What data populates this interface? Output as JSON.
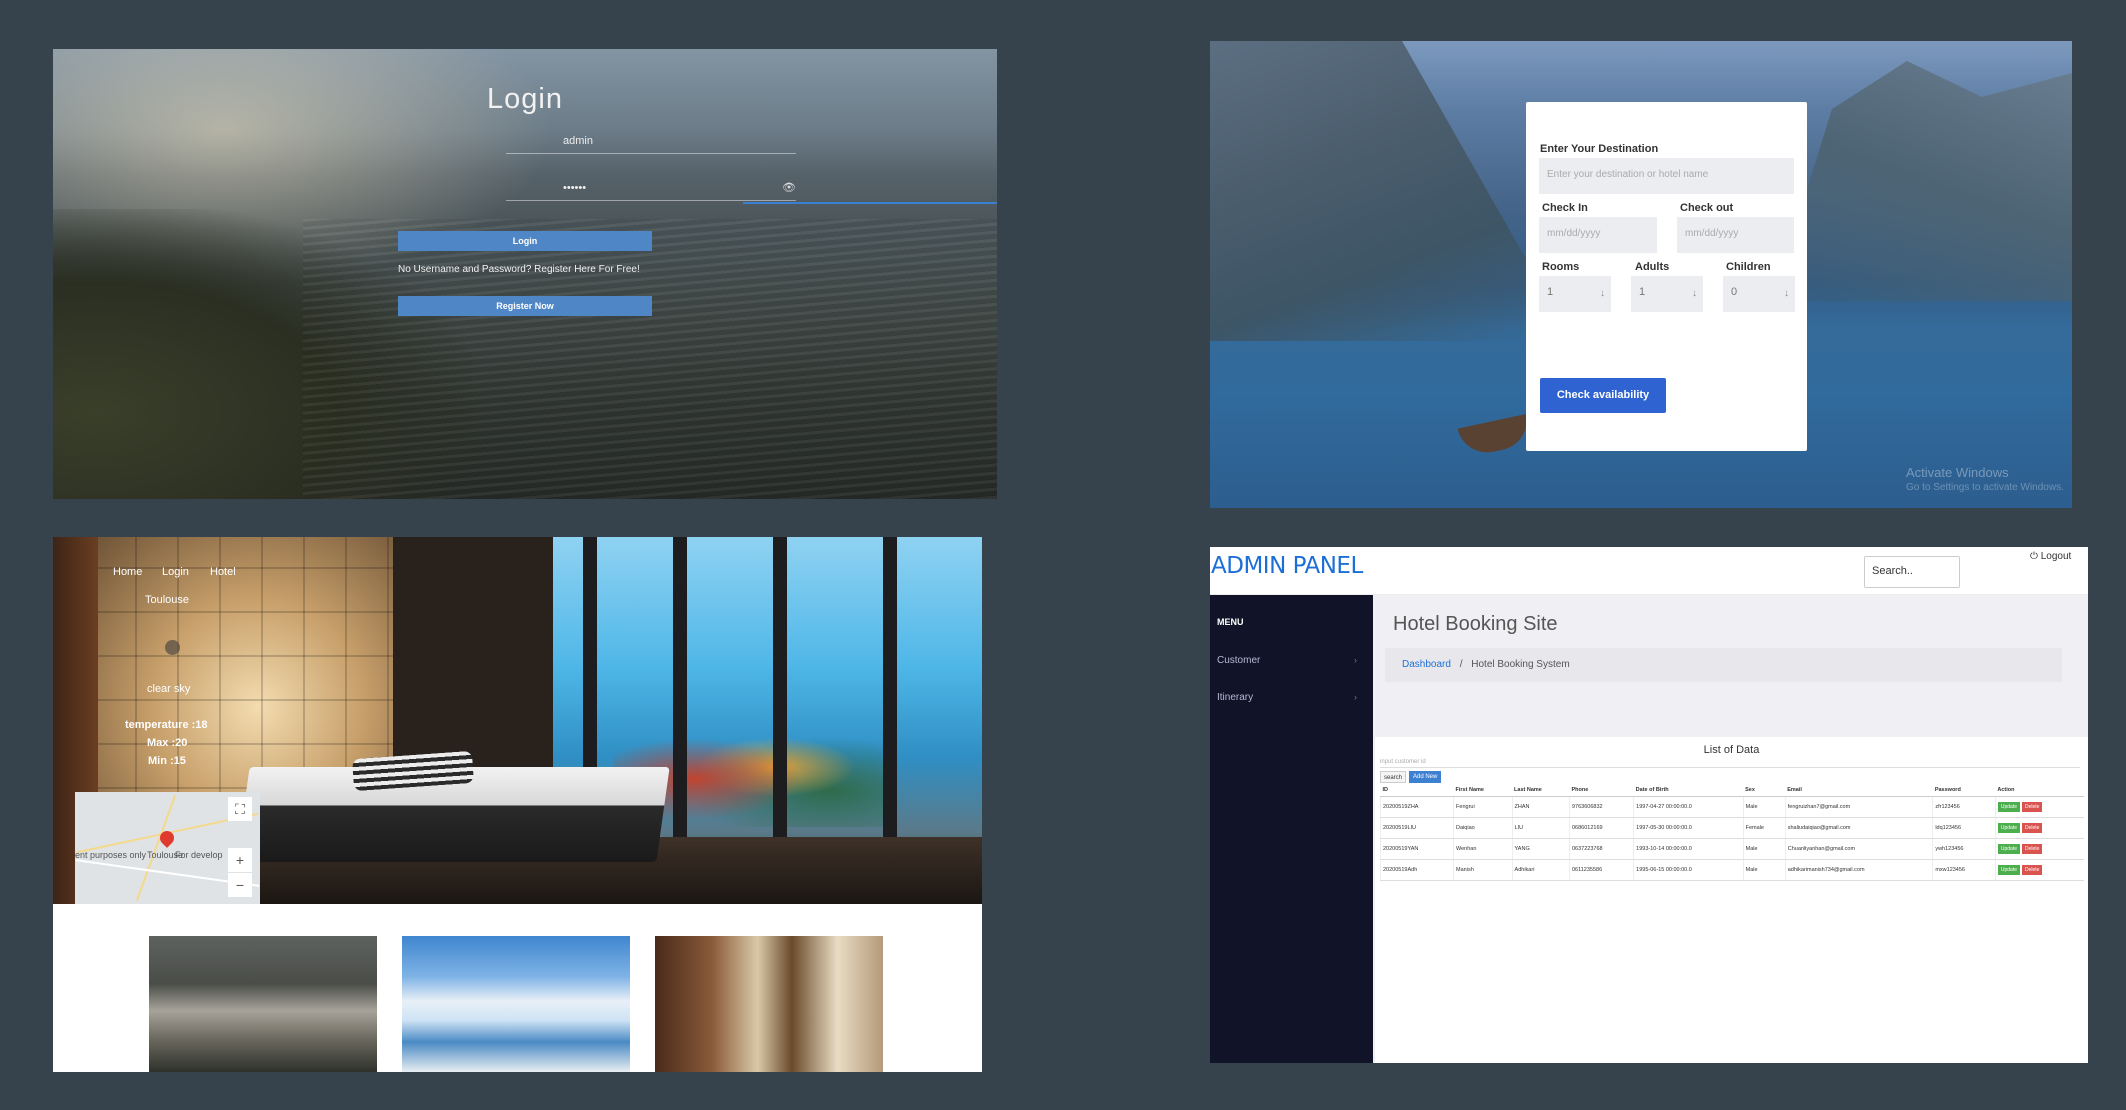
{
  "login": {
    "title": "Login",
    "username_value": "admin",
    "password_value": "••••••",
    "login_button": "Login",
    "register_note": "No Username and Password? Register Here For Free!",
    "register_button": "Register Now"
  },
  "booking": {
    "destination_label": "Enter Your Destination",
    "destination_placeholder": "Enter your destination or hotel name",
    "checkin_label": "Check In",
    "checkin_placeholder": "mm/dd/yyyy",
    "checkout_label": "Check out",
    "checkout_placeholder": "mm/dd/yyyy",
    "rooms_label": "Rooms",
    "rooms_value": "1",
    "adults_label": "Adults",
    "adults_value": "1",
    "children_label": "Children",
    "children_value": "0",
    "submit_button": "Check availability",
    "watermark_title": "Activate Windows",
    "watermark_sub": "Go to Settings to activate Windows."
  },
  "hotel": {
    "nav": [
      "Home",
      "Login",
      "Hotel"
    ],
    "city": "Toulouse",
    "weather": {
      "description": "clear sky",
      "temperature": "temperature :18",
      "max": "Max :20",
      "min": "Min :15"
    },
    "map": {
      "city_label": "Toulouse",
      "left_text": "ent purposes only",
      "right_text": "For develop",
      "zoom_in": "+",
      "zoom_out": "−",
      "fullscreen": "⛶"
    }
  },
  "admin": {
    "brand": "ADMIN PANEL",
    "search_value": "Search..",
    "logout": "Logout",
    "menu_title": "MENU",
    "menu_items": [
      "Customer",
      "Itinerary"
    ],
    "page_title": "Hotel Booking Site",
    "breadcrumb": {
      "link": "Dashboard",
      "separator": "/",
      "current": "Hotel Booking System"
    },
    "list_title": "List of Data",
    "filter_placeholder": "input customer id",
    "search_button": "search",
    "add_button": "Add New",
    "columns": [
      "ID",
      "First Name",
      "Last Name",
      "Phone",
      "Date of Birth",
      "Sex",
      "Email",
      "Password",
      "Action"
    ],
    "rows": [
      [
        "20200519ZHA",
        "Fengrui",
        "ZHAN",
        "9763606832",
        "1997-04-27 00:00:00.0",
        "Male",
        "fengruizhan7@gmail.com",
        "zfr123456"
      ],
      [
        "20200519LIU",
        "Daiqiao",
        "LIU",
        "0686012169",
        "1997-05-30 00:00:00.0",
        "Female",
        "shaliudaiqiao@gmail.com",
        "ldq123456"
      ],
      [
        "20200519YAN",
        "Wenhan",
        "YANG",
        "0637223768",
        "1993-10-14 00:00:00.0",
        "Male",
        "Chuanliyanhan@gmail.com",
        "ywh123456"
      ],
      [
        "20200519Adh",
        "Manish",
        "Adhikari",
        "0611235586",
        "1995-06-15 00:00:00.0",
        "Male",
        "adhikarimanish734@gmail.com",
        "mxw123456"
      ]
    ],
    "update_label": "Update",
    "delete_label": "Delete"
  },
  "colors": {
    "background": "#37434c",
    "login_button": "#4f86c6",
    "booking_button": "#2e63d1",
    "admin_brand": "#1d6fd8",
    "admin_sidebar": "#111428",
    "update": "#4cae4c",
    "delete": "#d9534f"
  }
}
